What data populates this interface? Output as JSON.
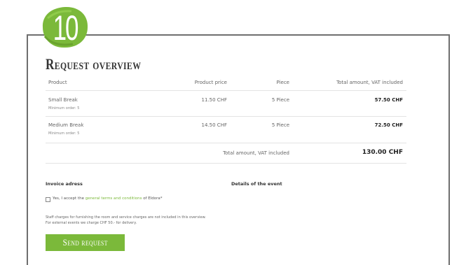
{
  "step_number": "10",
  "title": "Request overview",
  "table": {
    "headers": [
      "Product",
      "Product price",
      "Piece",
      "Total amount, VAT included"
    ],
    "rows": [
      {
        "product": "Small Break",
        "min_order": "Minimum order: 5",
        "price": "11.50 CHF",
        "piece": "5 Piece",
        "total": "57.50 CHF"
      },
      {
        "product": "Medium Break",
        "min_order": "Minimum order: 5",
        "price": "14.50 CHF",
        "piece": "5 Piece",
        "total": "72.50 CHF"
      }
    ],
    "total_label": "Total amount, VAT included",
    "total_value": "130.00 CHF"
  },
  "invoice_heading": "Invoice adress",
  "event_heading": "Details of the event",
  "terms": {
    "prefix": "Yes, I accept the ",
    "link": "general terms and conditions",
    "suffix": " of Eldora*",
    "checked": false
  },
  "note": "Staff charges for furnishing the room and service charges are not included in this overview. For external events we charge CHF 50.- for delivery.",
  "send_button": "Send request",
  "colors": {
    "accent": "#7bb93a",
    "frame": "#6f6f6f"
  }
}
